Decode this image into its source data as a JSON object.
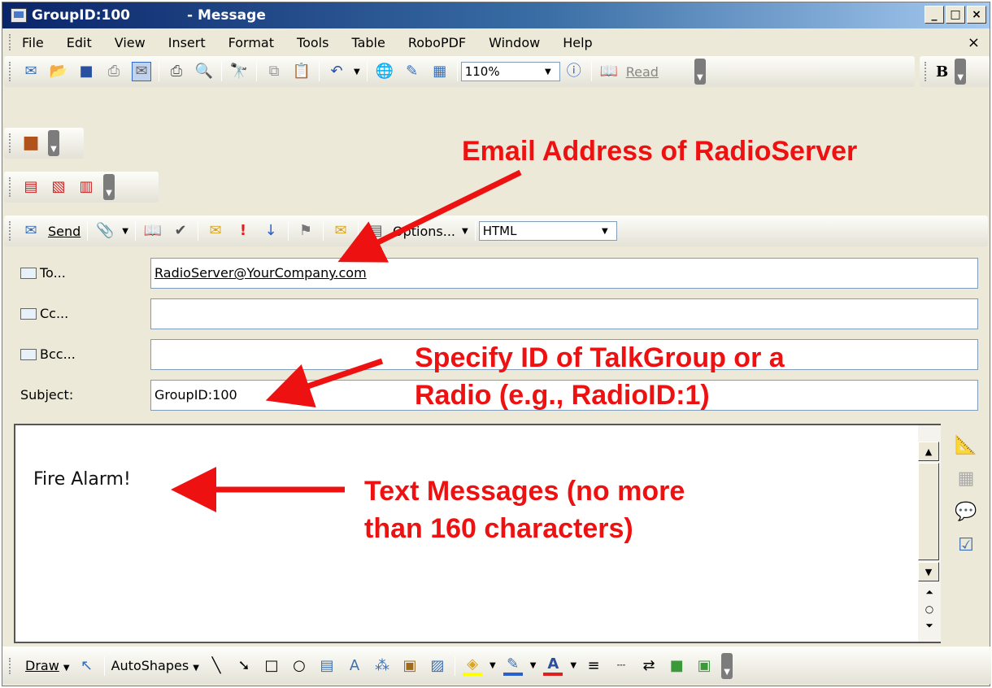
{
  "window": {
    "title_left": "GroupID:100",
    "title_right": "- Message",
    "btn_min": "_",
    "btn_max": "□",
    "btn_close": "×"
  },
  "menu": {
    "items": [
      "File",
      "Edit",
      "View",
      "Insert",
      "Format",
      "Tools",
      "Table",
      "RoboPDF",
      "Window",
      "Help"
    ],
    "close": "×"
  },
  "toolbar": {
    "zoom": "110%",
    "read": "Read",
    "bold": "B"
  },
  "send_toolbar": {
    "send": "Send",
    "options": "Options...",
    "format": "HTML"
  },
  "fields": {
    "to_label": "To...",
    "to_value": "RadioServer@YourCompany.com",
    "cc_label": "Cc...",
    "cc_value": "",
    "bcc_label": "Bcc...",
    "bcc_value": "",
    "subject_label": "Subject:",
    "subject_value": "GroupID:100"
  },
  "body": {
    "text": "Fire Alarm!"
  },
  "draw_toolbar": {
    "draw": "Draw",
    "autoshapes": "AutoShapes"
  },
  "annotations": {
    "email": "Email Address of RadioServer",
    "subject_line1": "Specify ID of TalkGroup or a",
    "subject_line2": "Radio (e.g., RadioID:1)",
    "text_line1": "Text Messages (no more",
    "text_line2": "than 160 characters)"
  },
  "colors": {
    "annotation": "#ee1111",
    "titlebar": "#0a246a"
  }
}
